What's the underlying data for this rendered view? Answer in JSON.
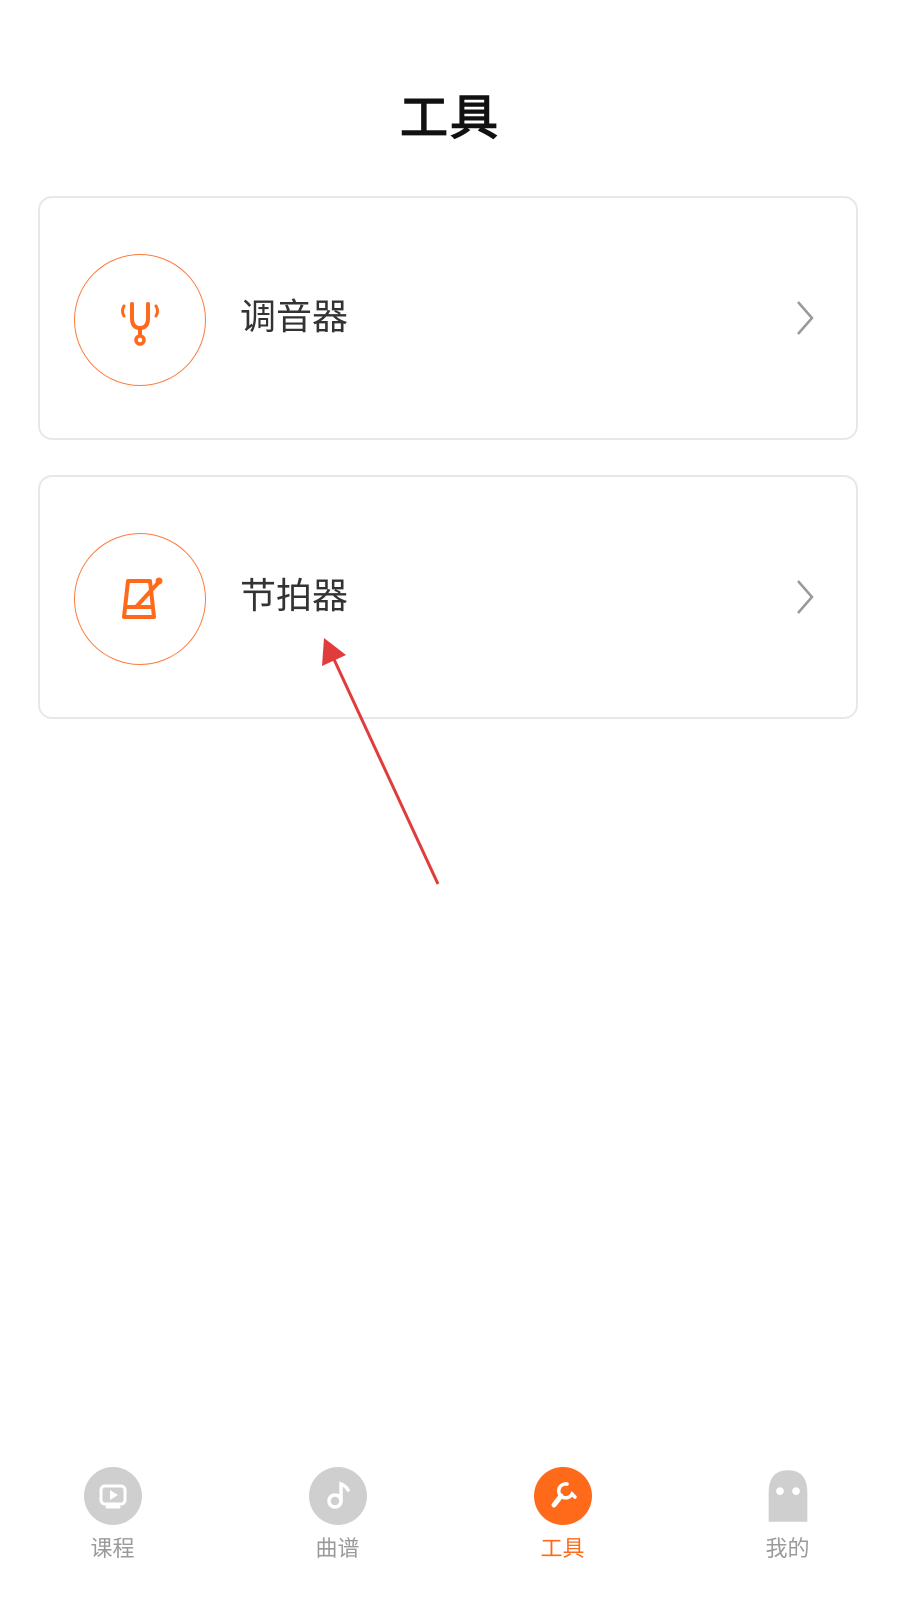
{
  "header": {
    "title": "工具"
  },
  "tools": [
    {
      "label": "调音器",
      "icon": "tuning-fork-icon"
    },
    {
      "label": "节拍器",
      "icon": "metronome-icon"
    }
  ],
  "tabs": [
    {
      "label": "课程",
      "icon": "course-play-icon",
      "active": false
    },
    {
      "label": "曲谱",
      "icon": "music-note-icon",
      "active": false
    },
    {
      "label": "工具",
      "icon": "wrench-icon",
      "active": true
    },
    {
      "label": "我的",
      "icon": "profile-ghost-icon",
      "active": false
    }
  ],
  "colors": {
    "accent": "#ff6a1a",
    "icon_ring": "#ff7a3d",
    "inactive_tab": "#cfcfcf",
    "inactive_label": "#9a9a9a",
    "annotation_arrow": "#e03c3c"
  }
}
